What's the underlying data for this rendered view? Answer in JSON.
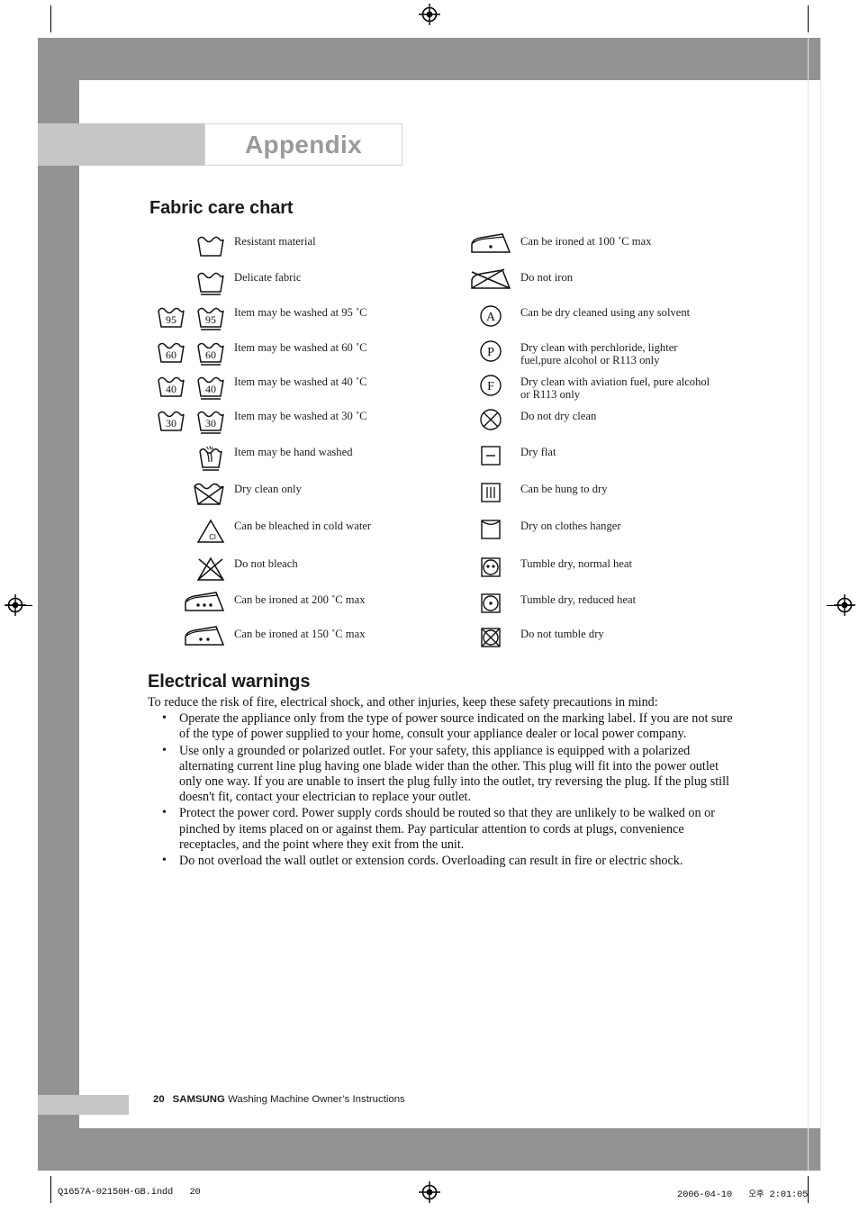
{
  "page": {
    "appendix_title": "Appendix",
    "section_fabric": "Fabric care chart",
    "section_electrical": "Electrical warnings"
  },
  "fabric_chart": {
    "left_column": [
      {
        "icon": "tub-plain",
        "label": "Resistant material"
      },
      {
        "icon": "tub-underline",
        "label": "Delicate fabric"
      },
      {
        "icon": "tub-pair-95",
        "label": "Item may be washed at 95 ˚C"
      },
      {
        "icon": "tub-pair-60",
        "label": "Item may be washed at 60 ˚C"
      },
      {
        "icon": "tub-pair-40",
        "label": "Item may be washed at 40 ˚C"
      },
      {
        "icon": "tub-pair-30",
        "label": "Item may be washed at 30 ˚C"
      },
      {
        "icon": "tub-hand-wash",
        "label": "Item may be hand washed"
      },
      {
        "icon": "tub-crossed",
        "label": "Dry clean only"
      },
      {
        "icon": "triangle-cl",
        "label": "Can be bleached in cold water"
      },
      {
        "icon": "triangle-crossed",
        "label": "Do not bleach"
      },
      {
        "icon": "iron-three-dots",
        "label": "Can be ironed at 200 ˚C max"
      },
      {
        "icon": "iron-two-dots",
        "label": "Can be ironed at 150 ˚C max"
      }
    ],
    "right_column": [
      {
        "icon": "iron-one-dot",
        "label": "Can be ironed at 100 ˚C max"
      },
      {
        "icon": "iron-crossed",
        "label": "Do not iron"
      },
      {
        "icon": "circle-a",
        "label": "Can be dry cleaned using any solvent"
      },
      {
        "icon": "circle-p",
        "label": "Dry clean with perchloride, lighter\nfuel,pure alcohol or R113 only"
      },
      {
        "icon": "circle-f",
        "label": "Dry clean with aviation fuel, pure alcohol\nor R113 only"
      },
      {
        "icon": "circle-crossed",
        "label": "Do not dry clean"
      },
      {
        "icon": "square-dash",
        "label": "Dry flat"
      },
      {
        "icon": "square-bars",
        "label": "Can be hung to dry"
      },
      {
        "icon": "square-arc",
        "label": "Dry on clothes hanger"
      },
      {
        "icon": "tumble-two-dots",
        "label": "Tumble dry, normal heat"
      },
      {
        "icon": "tumble-one-dot",
        "label": "Tumble dry, reduced heat"
      },
      {
        "icon": "tumble-crossed",
        "label": "Do not tumble dry"
      }
    ],
    "wash_temperatures": [
      "95",
      "60",
      "40",
      "30"
    ],
    "bleach_letters": {
      "cold_water": "Cl"
    },
    "solvent_letters": [
      "A",
      "P",
      "F"
    ]
  },
  "electrical_warnings": {
    "intro": "To reduce the risk of fire, electrical shock, and other injuries, keep these safety precautions in mind:",
    "bullet_marker": "•",
    "bullets": [
      "Operate the appliance only from the type of power source indicated on the marking label.  If you are not sure of the type of power supplied to your home, consult your appliance dealer or local power company.",
      "Use only a grounded or polarized outlet.  For your safety, this appliance is equipped with a polarized alternating current line plug having one blade wider than the other.  This plug will fit into the power outlet only one way.  If you are unable to insert the plug fully into the outlet, try reversing the plug.  If the plug still doesn't fit, contact your electrician to replace your outlet.",
      "Protect the power cord. Power supply cords should be routed so that they are unlikely to be walked on or pinched by items placed on or against them.  Pay particular attention to cords at plugs, convenience receptacles, and the point where they exit from the unit.",
      "Do not overload the wall outlet or extension cords.  Overloading can result in fire or electric shock."
    ]
  },
  "footer": {
    "page_number": "20",
    "brand": "SAMSUNG",
    "doc_title": "Washing Machine Owner’s Instructions"
  },
  "print_marks": {
    "file_name": "Q1657A-02150H-GB.indd",
    "file_page": "20",
    "date": "2006-04-10",
    "meridiem": "오후",
    "time": "2:01:05"
  },
  "colors": {
    "band_gray": "#939393",
    "tab_light_gray": "#c6c6c6",
    "appendix_text": "#9a9a9a",
    "body_text": "#111111"
  }
}
